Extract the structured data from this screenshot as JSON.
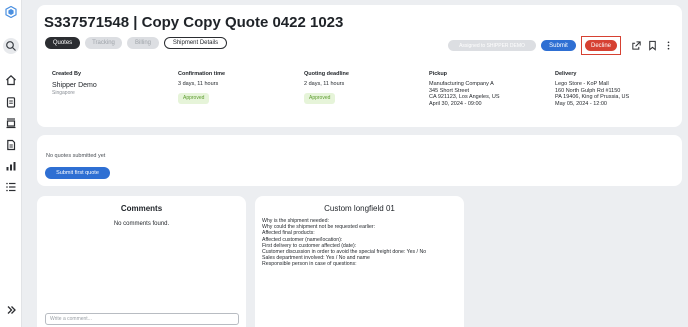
{
  "sidebar": {
    "icons": [
      "logo-icon",
      "search-icon",
      "home-icon",
      "clipboard-icon",
      "truck-icon",
      "document-icon",
      "chart-icon",
      "list-icon",
      "expand-icon"
    ]
  },
  "header": {
    "title": "S337571548 | Copy Copy Quote 0422 1023",
    "tabs": {
      "quotes": "Quotes",
      "tracking": "Tracking",
      "billing": "Billing",
      "details": "Shipment Details"
    },
    "actions": {
      "assigned": "Assigned to SHIPPER DEMO",
      "submit": "Submit",
      "decline": "Decline"
    }
  },
  "info": {
    "created_by": {
      "label": "Created By",
      "name": "Shipper Demo",
      "sub": "Singapore"
    },
    "confirmation": {
      "label": "Confirmation time",
      "value": "3 days, 11 hours",
      "badge": "Approved"
    },
    "deadline": {
      "label": "Quoting deadline",
      "value": "2 days, 11 hours",
      "badge": "Approved"
    },
    "pickup": {
      "label": "Pickup",
      "lines": [
        "Manufacturing Company A",
        "345 Short Street",
        "CA 921123, Los Angeles, US",
        "April 30, 2024 - 09:00"
      ]
    },
    "delivery": {
      "label": "Delivery",
      "lines": [
        "Lego Store - KoP Mall",
        "160 North Gulph Rd #1150",
        "PA 19406, King of Prussia, US",
        "May 05, 2024 - 12:00"
      ]
    }
  },
  "quotes": {
    "empty": "No quotes submitted yet",
    "button": "Submit first quote"
  },
  "comments": {
    "title": "Comments",
    "empty": "No comments found.",
    "placeholder": "Write a comment..."
  },
  "custom": {
    "title": "Custom longfield 01",
    "lines": [
      "Why is the shipment needed:",
      "Why could the shipment not be requested earlier:",
      "Affected final products:",
      "Affected customer (name/location):",
      "First delivery to customer affected (date):",
      "Customer discussion in order to avoid the special freight done: Yes / No",
      "Sales department involved: Yes / No and name",
      "Responsible person in case of questions:"
    ]
  },
  "colors": {
    "primary": "#2e6fd3",
    "decline": "#d64132",
    "approved_bg": "#e6f4d9",
    "approved_text": "#5b9b2d"
  }
}
